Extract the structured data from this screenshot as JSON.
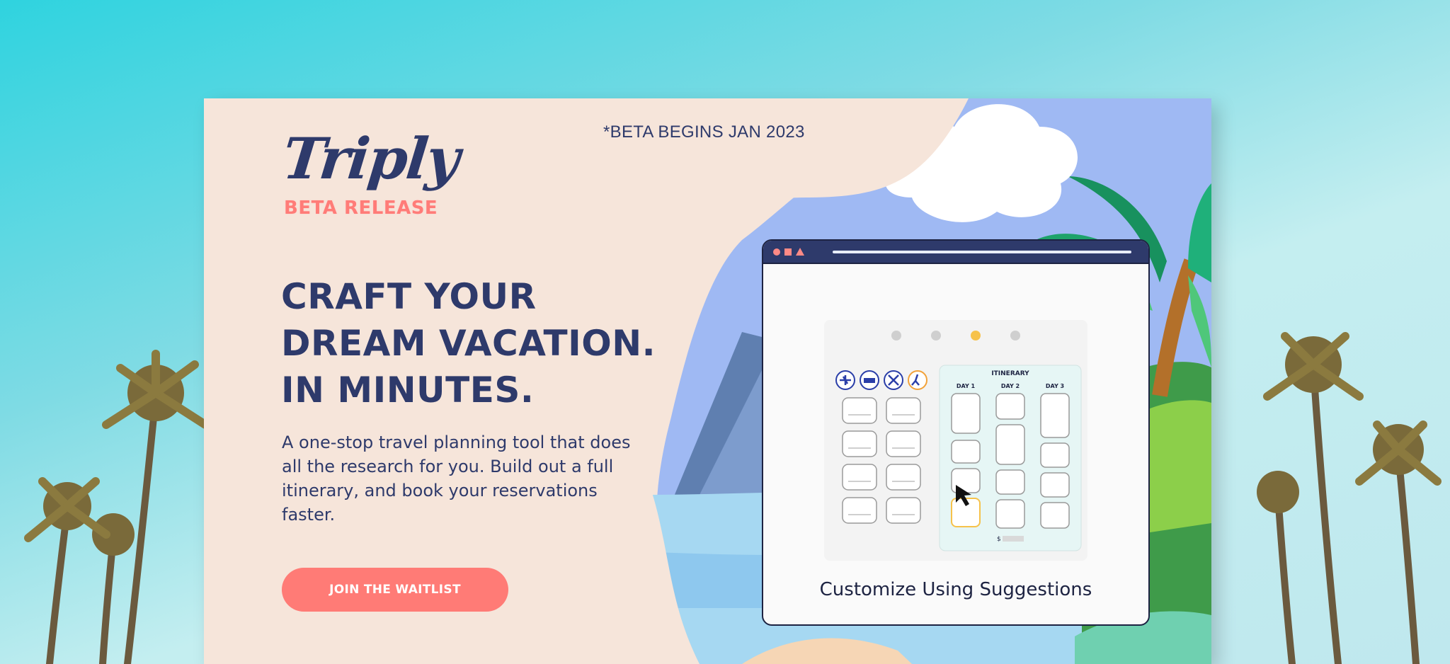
{
  "brand": {
    "logo": "Triply",
    "tagline": "BETA RELEASE"
  },
  "announcement": "*BETA  BEGINS JAN 2023",
  "hero": {
    "headline": [
      "CRAFT YOUR",
      "DREAM VACATION.",
      "IN MINUTES."
    ],
    "description": "A one-stop travel planning tool that does all the research for you. Build out a full itinerary, and book your reservations faster.",
    "cta_label": "JOIN THE WAITLIST"
  },
  "preview": {
    "caption": "Customize Using Suggestions",
    "itinerary_title": "ITINERARY",
    "days": [
      "DAY 1",
      "DAY 2",
      "DAY 3"
    ],
    "price_symbol": "$",
    "carousel_active_index": 3,
    "carousel_count": 4
  },
  "icons": [
    "plane-icon",
    "bed-icon",
    "dining-icon",
    "hiking-icon"
  ],
  "colors": {
    "navy": "#2e3a6b",
    "coral": "#ff7b76",
    "cream": "#f6e5da",
    "teal": "#2fd3df"
  }
}
